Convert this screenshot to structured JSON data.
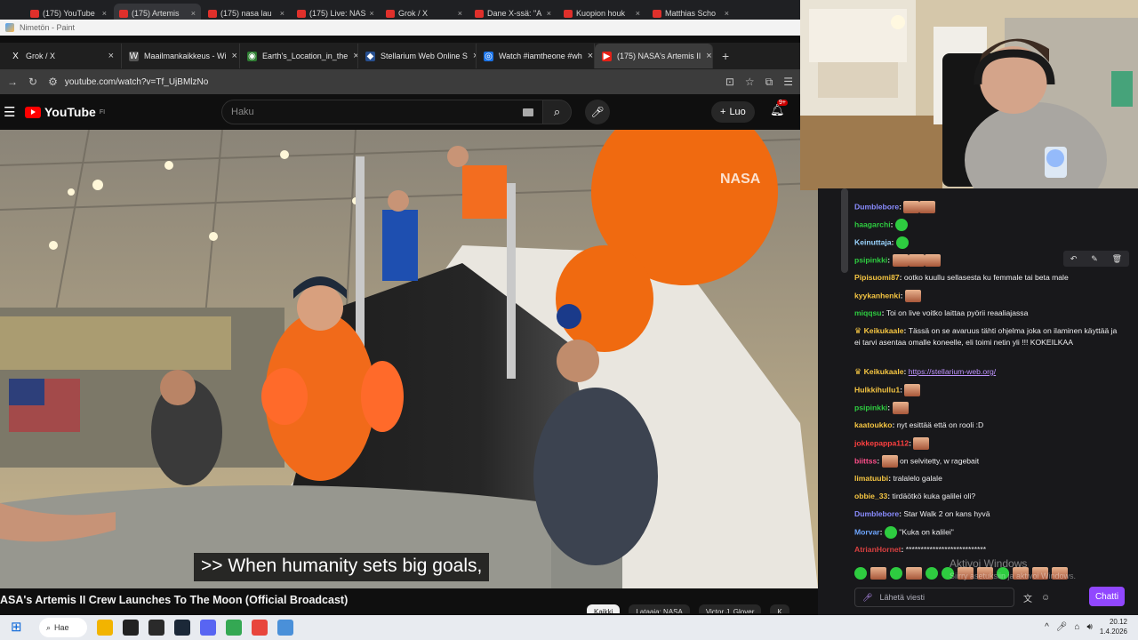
{
  "browser_back_tabs": [
    {
      "label": "(175) YouTube",
      "active": false
    },
    {
      "label": "(175) Artemis",
      "active": true
    },
    {
      "label": "(175) nasa lau",
      "active": false
    },
    {
      "label": "(175) Live: NAS",
      "active": false
    },
    {
      "label": "Grok / X",
      "active": false
    },
    {
      "label": "Dane X-ssä: \"A",
      "active": false
    },
    {
      "label": "Kuopion houk",
      "active": false
    },
    {
      "label": "Matthias Scho",
      "active": false
    }
  ],
  "paint": {
    "title": "Nimetön - Paint"
  },
  "browser_front_tabs": [
    {
      "label": "Grok / X",
      "icon": "X",
      "color": "#1f1f1f",
      "active": false
    },
    {
      "label": "Maailmankaikkeus - Wi",
      "icon": "W",
      "color": "#555555",
      "active": false
    },
    {
      "label": "Earth's_Location_in_the",
      "icon": "◉",
      "color": "#2e7d32",
      "active": false
    },
    {
      "label": "Stellarium Web Online S",
      "icon": "◆",
      "color": "#274f8f",
      "active": false
    },
    {
      "label": "Watch #iamtheone #wh",
      "icon": "◎",
      "color": "#1a73e8",
      "active": false
    },
    {
      "label": "(175) NASA's Artemis II",
      "icon": "▶",
      "color": "#e62117",
      "active": true
    }
  ],
  "address": {
    "url": "youtube.com/watch?v=Tf_UjBMlzNo"
  },
  "youtube": {
    "logo_text": "YouTube",
    "region": "FI",
    "search_placeholder": "Haku",
    "create_label": "Luo",
    "notif_badge": "9+"
  },
  "video": {
    "caption": ">> When humanity sets big goals,",
    "title": "ASA's Artemis II Crew Launches To The Moon (Official Broadcast)"
  },
  "chips": [
    "Kaikki",
    "Lataaja: NASA",
    "Victor J. Glover",
    "K"
  ],
  "chat": {
    "messages": [
      {
        "user": "Dumblebore",
        "color": "#8a8cff",
        "text": "",
        "emotes": [
          "face",
          "face"
        ]
      },
      {
        "user": "haagarchi",
        "color": "#2ecc40",
        "text": "",
        "emotes": [
          "green"
        ]
      },
      {
        "user": "Keinuttaja",
        "color": "#9ad4ff",
        "text": "",
        "emotes": [
          "green"
        ]
      },
      {
        "user": "psipinkki",
        "color": "#2ecc40",
        "text": "",
        "emotes": [
          "face",
          "face",
          "face"
        ]
      },
      {
        "user": "Pipisuomi87",
        "color": "#f5c542",
        "text": "ootko kuullu sellasesta ku femmale tai beta male",
        "emotes": []
      },
      {
        "user": "kyykanhenki",
        "color": "#f5c542",
        "text": "",
        "emotes": [
          "face"
        ]
      },
      {
        "user": "miqqsu",
        "color": "#2ecc40",
        "text": "Toi on live voitko laittaa pyörii reaaliajassa",
        "emotes": []
      },
      {
        "user": "Keikukaale",
        "color": "#f5c542",
        "text": "Tässä on se avaruus tähti ohjelma joka on ilaminen käyttää ja ei tarvi asentaa omalle koneelle, eli toimi netin yli !!! KOKEILKAA",
        "emotes": []
      },
      {
        "user": "Keikukaale",
        "color": "#f5c542",
        "text": "https://stellarium-web.org/",
        "emotes": []
      },
      {
        "user": "Hulkkihullu1",
        "color": "#f5c542",
        "text": "",
        "emotes": [
          "face"
        ]
      },
      {
        "user": "psipinkki",
        "color": "#2ecc40",
        "text": "",
        "emotes": [
          "face"
        ]
      },
      {
        "user": "kaatoukko",
        "color": "#f5c542",
        "text": "nyt esittää että on rooli :D",
        "emotes": []
      },
      {
        "user": "jokkepappa112",
        "color": "#ff4040",
        "text": "",
        "emotes": [
          "face"
        ]
      },
      {
        "user": "biittss",
        "color": "#ff4f8b",
        "text": "on selvitetty, w ragebait",
        "emotes": [
          "face"
        ]
      },
      {
        "user": "limatuubi",
        "color": "#f5c542",
        "text": "tralalelo galale",
        "emotes": []
      },
      {
        "user": "obbie_33",
        "color": "#f5c542",
        "text": "tirdäötkö kuka galilei oli?",
        "emotes": []
      },
      {
        "user": "Dumblebore",
        "color": "#8a8cff",
        "text": "Star Walk 2 on kans hyvä",
        "emotes": []
      },
      {
        "user": "Morvar",
        "color": "#6ea6ff",
        "text": "\"Kuka on kalilei\"",
        "emotes": [
          "green"
        ]
      },
      {
        "user": "AtrianHornet",
        "color": "#d94040",
        "text": "***************************",
        "emotes": []
      }
    ],
    "input_placeholder": "Lähetä viesti",
    "send_label": "Chatti"
  },
  "watermark": {
    "line1": "Aktivoi Windows",
    "line2": "Siirry asetuksiin ja aktivoi Windows."
  },
  "taskbar": {
    "search_label": "Hae",
    "time": "20.12",
    "date": "1.4.2026",
    "apps": [
      "#f2b400",
      "#222222",
      "#2a2a2a",
      "#1b2838",
      "#5865f2",
      "#34a853",
      "#e8453c",
      "#4a90d9"
    ]
  },
  "colors": {
    "accent_purple": "#9147ff",
    "youtube_red": "#ff0000"
  }
}
